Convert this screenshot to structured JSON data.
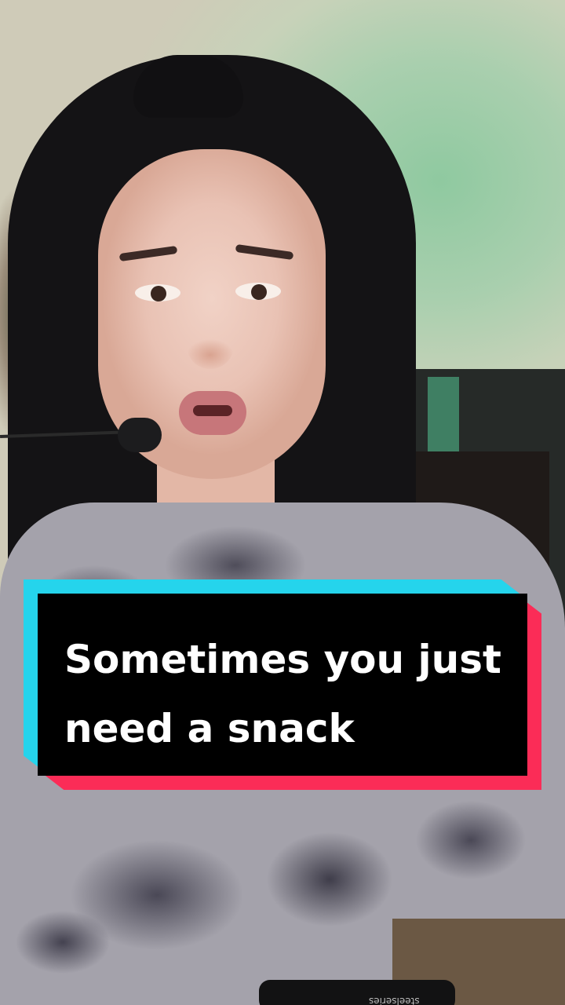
{
  "video": {
    "caption_line_1": "Sometimes you just",
    "caption_line_2": "need a snack",
    "keyboard_brand_text": "steelseries"
  },
  "colors": {
    "caption_background": "#000000",
    "caption_text": "#ffffff",
    "caption_accent_cyan": "#25d4ec",
    "caption_accent_red": "#fb2c57"
  },
  "icons": {
    "microphone": "mic-icon"
  }
}
